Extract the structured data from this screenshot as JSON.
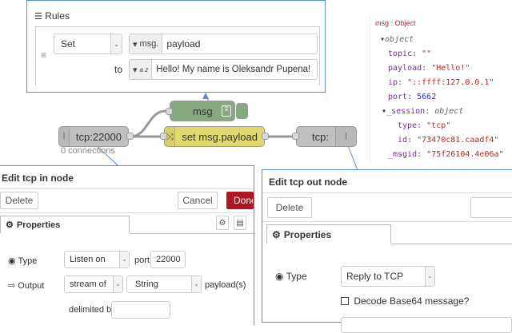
{
  "rules_panel": {
    "title": "Rules",
    "action": "Set",
    "target_prefix": "msg.",
    "target_value": "payload",
    "to_label": "to",
    "value_type_icon": "a z",
    "value": "Hello! My name is Oleksandr Pupena!"
  },
  "debug": {
    "header": "msg : Object",
    "object_label": "object",
    "topic_key": "topic:",
    "topic_val": "\"\"",
    "payload_key": "payload:",
    "payload_val": "\"Hello!\"",
    "ip_key": "ip:",
    "ip_val": "\"::ffff:127.0.0.1\"",
    "port_key": "port:",
    "port_val": "5662",
    "session_key": "_session:",
    "session_label": "object",
    "type_key": "type:",
    "type_val": "\"tcp\"",
    "id_key": "id:",
    "id_val": "\"73470c81.caadf4\"",
    "msgid_key": "_msgid:",
    "msgid_val": "\"75f26104.4e06a\""
  },
  "flow": {
    "tcp_in_label": "tcp:22000",
    "tcp_in_status": "0 connections",
    "change_label": "set msg.payload",
    "debug_label": "msg",
    "tcp_out_label": "tcp:",
    "colors": {
      "tcp": "#c0c0c0",
      "change": "#e2d96e",
      "debug": "#87a980",
      "wire": "#999999"
    }
  },
  "tcp_in_dialog": {
    "title": "Edit tcp in node",
    "delete_label": "Delete",
    "cancel_label": "Cancel",
    "done_label": "Done",
    "tab_label": "Properties",
    "type_label": "Type",
    "type_value": "Listen on",
    "port_label": "port",
    "port_value": "22000",
    "output_label": "Output",
    "output_value": "stream of",
    "output_format": "String",
    "output_suffix": "payload(s)",
    "delimited_label": "delimited by",
    "delimited_value": ""
  },
  "tcp_out_dialog": {
    "title": "Edit tcp out node",
    "delete_label": "Delete",
    "tab_label": "Properties",
    "type_label": "Type",
    "type_value": "Reply to TCP",
    "decode_label": "Decode Base64 message?"
  }
}
